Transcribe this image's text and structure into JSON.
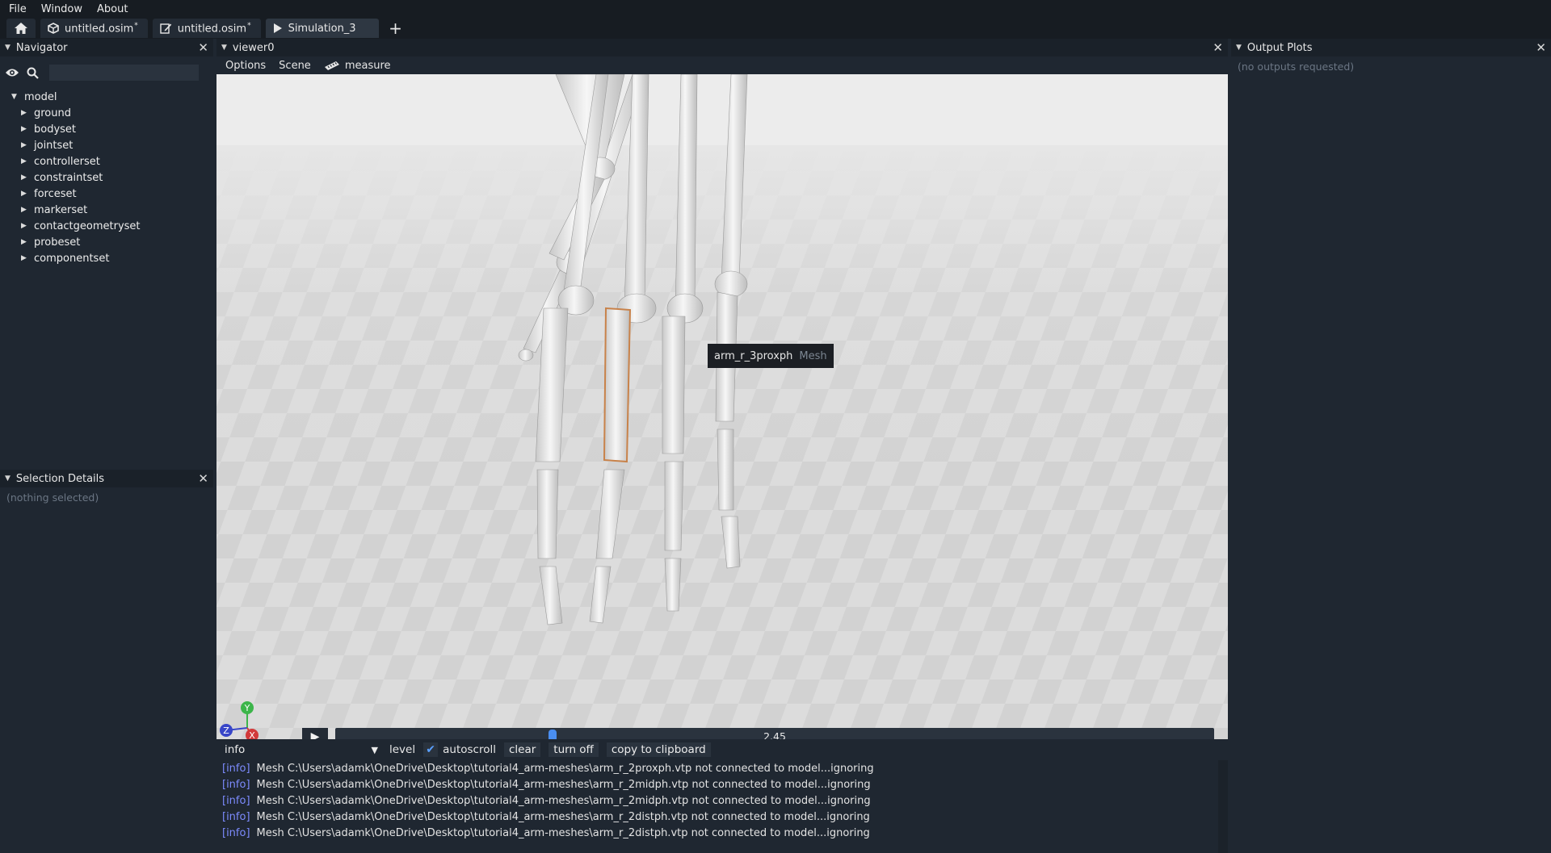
{
  "menu": {
    "items": [
      "File",
      "Window",
      "About"
    ]
  },
  "tabs": [
    {
      "label": "untitled.osim",
      "modified": "*",
      "icon": "cube-icon"
    },
    {
      "label": "untitled.osim",
      "modified": "*",
      "icon": "edit-icon"
    },
    {
      "label": "Simulation_3",
      "modified": "",
      "icon": "play-icon"
    }
  ],
  "navigator": {
    "title": "Navigator",
    "search_placeholder": "",
    "root": "model",
    "children": [
      "ground",
      "bodyset",
      "jointset",
      "controllerset",
      "constraintset",
      "forceset",
      "markerset",
      "contactgeometryset",
      "probeset",
      "componentset"
    ]
  },
  "selection": {
    "title": "Selection Details",
    "empty_text": "(nothing selected)"
  },
  "viewer": {
    "title": "viewer0",
    "toolbar": {
      "options": "Options",
      "scene": "Scene",
      "measure": "measure"
    },
    "tooltip": {
      "name": "arm_r_3proxph",
      "type": "Mesh"
    },
    "axes": {
      "y": "Y",
      "z": "Z",
      "x": "X"
    },
    "playback": {
      "time": "2.45",
      "progress": 0.245
    }
  },
  "output": {
    "title": "Output Plots",
    "empty_text": "(no outputs requested)"
  },
  "log": {
    "level": "info",
    "level_label": "level",
    "autoscroll": "autoscroll",
    "clear": "clear",
    "turn_off": "turn off",
    "copy": "copy to clipboard",
    "lines": [
      {
        "lvl": "[info]",
        "text": "Mesh C:\\Users\\adamk\\OneDrive\\Desktop\\tutorial4_arm-meshes\\arm_r_2proxph.vtp not connected to model...ignoring"
      },
      {
        "lvl": "[info]",
        "text": "Mesh C:\\Users\\adamk\\OneDrive\\Desktop\\tutorial4_arm-meshes\\arm_r_2midph.vtp not connected to model...ignoring"
      },
      {
        "lvl": "[info]",
        "text": "Mesh C:\\Users\\adamk\\OneDrive\\Desktop\\tutorial4_arm-meshes\\arm_r_2midph.vtp not connected to model...ignoring"
      },
      {
        "lvl": "[info]",
        "text": "Mesh C:\\Users\\adamk\\OneDrive\\Desktop\\tutorial4_arm-meshes\\arm_r_2distph.vtp not connected to model...ignoring"
      },
      {
        "lvl": "[info]",
        "text": "Mesh C:\\Users\\adamk\\OneDrive\\Desktop\\tutorial4_arm-meshes\\arm_r_2distph.vtp not connected to model...ignoring"
      }
    ]
  },
  "colors": {
    "background": "#1f2731",
    "accent": "#4a8ef0",
    "selection_outline": "#c8824a",
    "axis_y": "#3cb54a",
    "axis_x": "#d23a3a",
    "axis_z": "#3846c8"
  }
}
